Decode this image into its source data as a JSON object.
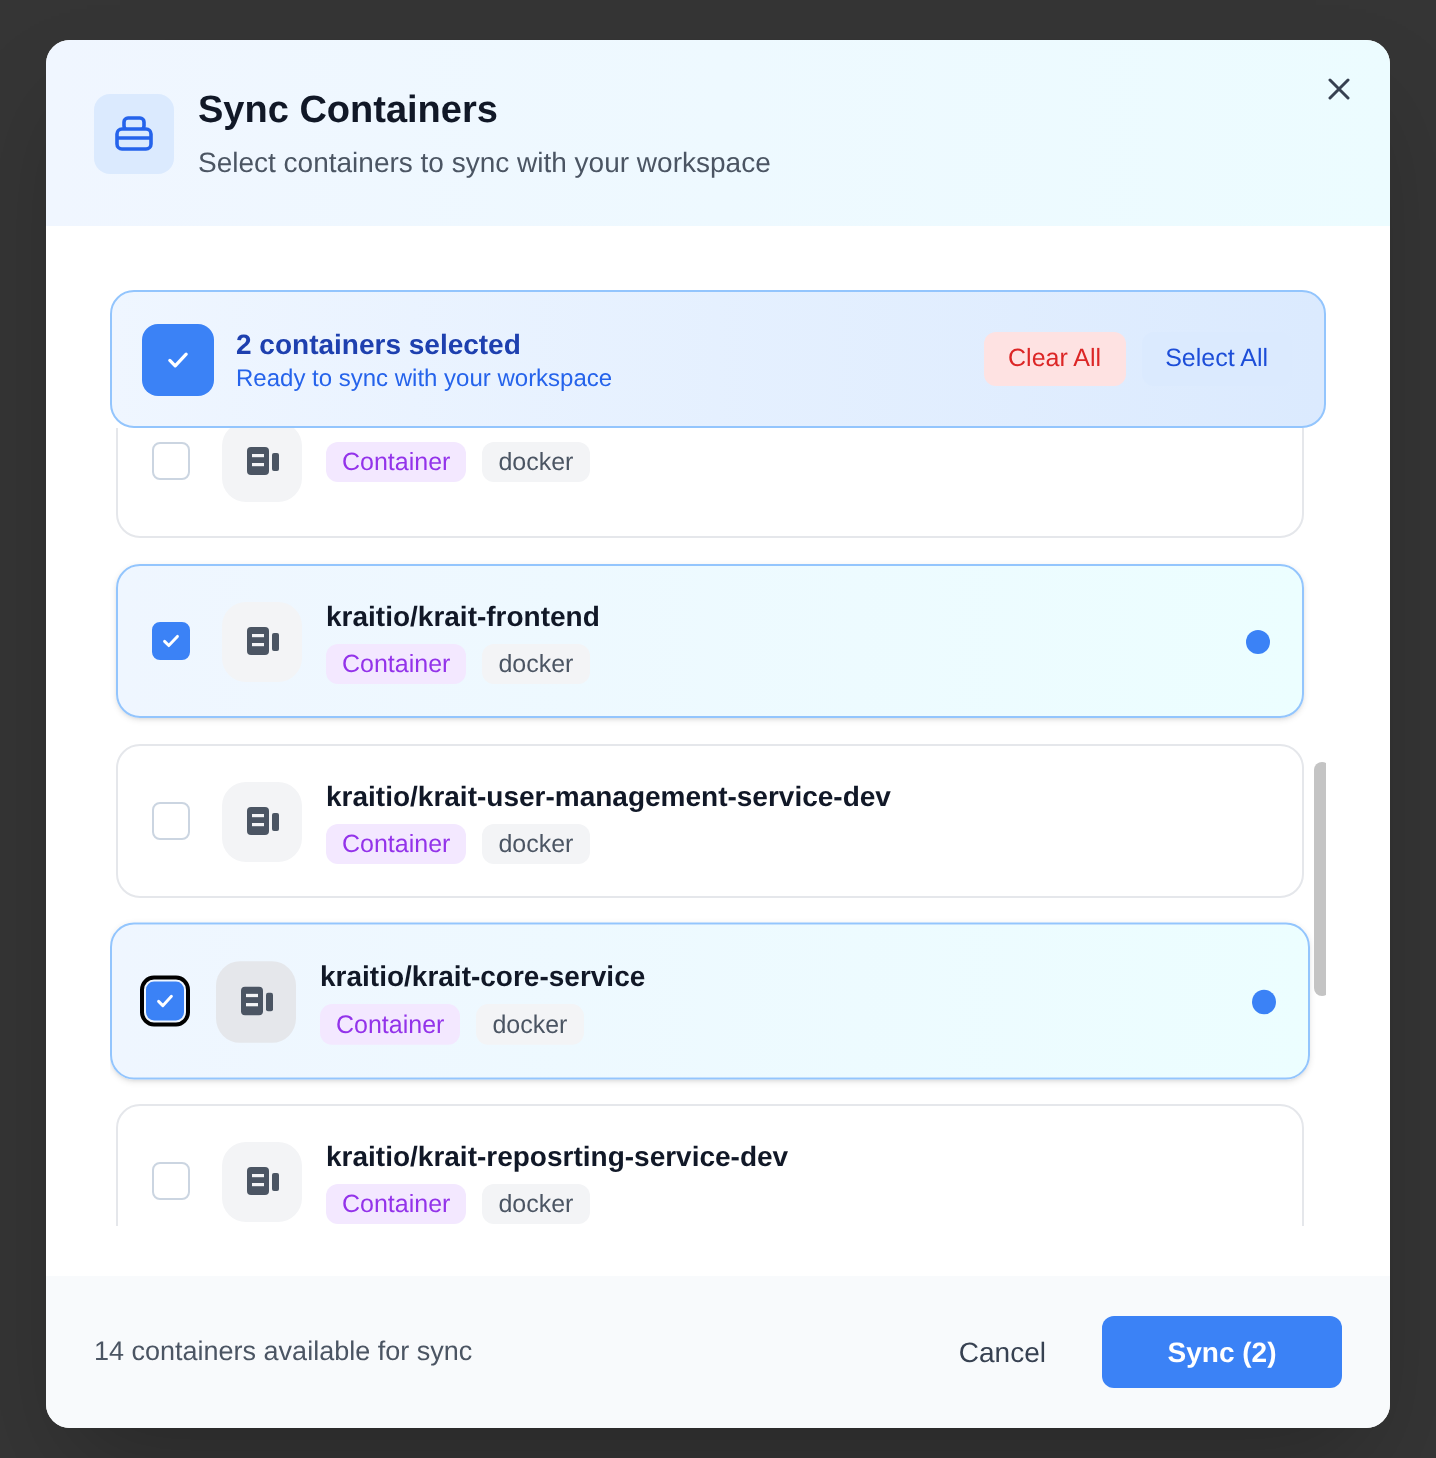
{
  "dialog": {
    "title": "Sync Containers",
    "subtitle": "Select containers to sync with your workspace"
  },
  "selection_banner": {
    "checked": true,
    "count_text": "2 containers selected",
    "hint": "Ready to sync with your workspace",
    "clear_button": "Clear All",
    "select_all_button": "Select All"
  },
  "containers": [
    {
      "tags": [
        "Container",
        "docker"
      ],
      "selected": false,
      "focused": false
    },
    {
      "name": "kraitio/krait-frontend",
      "tags": [
        "Container",
        "docker"
      ],
      "selected": true,
      "focused": false
    },
    {
      "name": "kraitio/krait-user-management-service-dev",
      "tags": [
        "Container",
        "docker"
      ],
      "selected": false,
      "focused": false
    },
    {
      "name": "kraitio/krait-core-service",
      "tags": [
        "Container",
        "docker"
      ],
      "selected": true,
      "focused": true
    },
    {
      "name": "kraitio/krait-reposrting-service-dev",
      "tags": [
        "Container",
        "docker"
      ],
      "selected": false,
      "focused": false
    }
  ],
  "footer": {
    "summary": "14 containers available for sync",
    "cancel_button": "Cancel",
    "sync_button": "Sync (2)"
  }
}
